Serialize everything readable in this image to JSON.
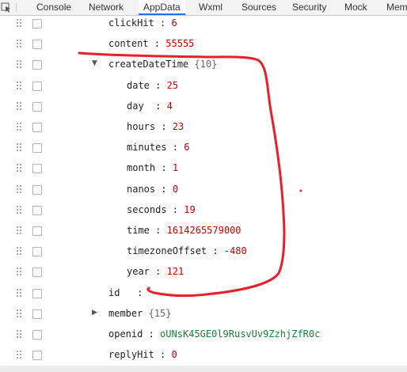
{
  "devtools": {
    "tabs": [
      "Console",
      "Network",
      "AppData",
      "Wxml",
      "Sources",
      "Security",
      "Mock",
      "Memory"
    ],
    "active_tab": "AppData"
  },
  "rows": [
    {
      "key": "clickHit",
      "value": "6",
      "type": "num"
    },
    {
      "key": "content",
      "value": "55555",
      "type": "num"
    },
    {
      "key": "createDateTime",
      "count": "{10}",
      "type": "object",
      "expanded": true
    },
    {
      "key": "date",
      "value": "25",
      "type": "num"
    },
    {
      "key": "day",
      "value": "4",
      "type": "num"
    },
    {
      "key": "hours",
      "value": "23",
      "type": "num"
    },
    {
      "key": "minutes",
      "value": "6",
      "type": "num"
    },
    {
      "key": "month",
      "value": "1",
      "type": "num"
    },
    {
      "key": "nanos",
      "value": "0",
      "type": "num"
    },
    {
      "key": "seconds",
      "value": "19",
      "type": "num"
    },
    {
      "key": "time",
      "value": "1614265579000",
      "type": "num"
    },
    {
      "key": "timezoneOffset",
      "value": "-480",
      "type": "num"
    },
    {
      "key": "year",
      "value": "121",
      "type": "num"
    },
    {
      "key": "id",
      "value": "",
      "type": "num"
    },
    {
      "key": "member",
      "count": "{15}",
      "type": "object",
      "expanded": false
    },
    {
      "key": "openid",
      "value": "oUNsK45GE0l9RusvUv9ZzhjZfR0c",
      "type": "str"
    },
    {
      "key": "replyHit",
      "value": "0",
      "type": "num"
    }
  ],
  "colors": {
    "number": "#c80000",
    "string": "#1a7f37",
    "annotation": "#e8202a",
    "active_tab_underline": "#1a73e8"
  },
  "icons": [
    "inspect-element-icon",
    "drag-handle-icon",
    "checkbox",
    "expand-arrow-icon",
    "collapse-arrow-icon"
  ]
}
